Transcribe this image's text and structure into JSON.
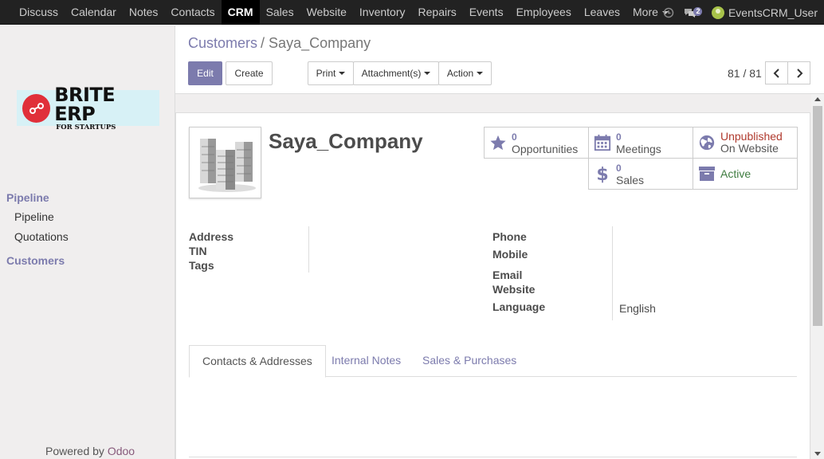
{
  "topnav": {
    "items": [
      "Discuss",
      "Calendar",
      "Notes",
      "Contacts",
      "CRM",
      "Sales",
      "Website",
      "Inventory",
      "Repairs",
      "Events",
      "Employees",
      "Leaves"
    ],
    "active": "CRM",
    "more_label": "More",
    "chat_count": "2",
    "user": "EventsCRM_User"
  },
  "sidebar": {
    "logo_main": "BRITE ERP",
    "logo_sub": "FOR STARTUPS",
    "section1": "Pipeline",
    "items": [
      "Pipeline",
      "Quotations"
    ],
    "section2": "Customers",
    "powered_prefix": "Powered by",
    "powered_brand": "Odoo"
  },
  "control_panel": {
    "breadcrumb_parent": "Customers",
    "breadcrumb_sep": "/",
    "breadcrumb_current": "Saya_Company",
    "edit_label": "Edit",
    "create_label": "Create",
    "print_label": "Print",
    "attachments_label": "Attachment(s)",
    "action_label": "Action",
    "pager": "81 / 81"
  },
  "form": {
    "name": "Saya_Company",
    "stats": {
      "opportunities_count": "0",
      "opportunities_label": "Opportunities",
      "meetings_count": "0",
      "meetings_label": "Meetings",
      "website_status": "Unpublished",
      "website_label": "On Website",
      "sales_count": "0",
      "sales_label": "Sales",
      "active_label": "Active"
    },
    "left_fields": {
      "address": "Address",
      "tin": "TIN",
      "tags": "Tags"
    },
    "right_fields": {
      "phone": "Phone",
      "mobile": "Mobile",
      "email": "Email",
      "website": "Website",
      "language": "Language",
      "language_value": "English"
    },
    "tabs": [
      "Contacts & Addresses",
      "Internal Notes",
      "Sales & Purchases"
    ],
    "active_tab": "Contacts & Addresses"
  },
  "colors": {
    "accent": "#7c7bad",
    "topbar": "#222222",
    "unpublished": "#b03a2e",
    "active": "#3f7d40"
  }
}
